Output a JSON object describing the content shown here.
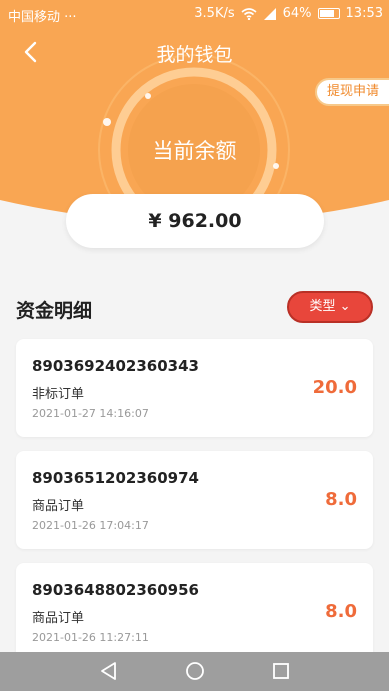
{
  "status_bar": {
    "carrier": "中国移动 ···",
    "network_speed": "3.5K/s",
    "battery": "64%",
    "time": "13:53"
  },
  "header": {
    "title": "我的钱包",
    "withdraw_label": "提现申请",
    "balance_label": "当前余额",
    "balance_value": "¥ 962.00"
  },
  "details": {
    "section_title": "资金明细",
    "filter_label": "类型 ⌄",
    "records": [
      {
        "order_no": "8903692402360343",
        "type": "非标订单",
        "time": "2021-01-27 14:16:07",
        "amount": "20.0"
      },
      {
        "order_no": "8903651202360974",
        "type": "商品订单",
        "time": "2021-01-26 17:04:17",
        "amount": "8.0"
      },
      {
        "order_no": "8903648802360956",
        "type": "商品订单",
        "time": "2021-01-26 11:27:11",
        "amount": "8.0"
      }
    ]
  },
  "colors": {
    "header_orange": "#f9a653",
    "accent_red": "#e8463b",
    "amount_orange": "#ef6b3a"
  },
  "icons": [
    "back-arrow-icon",
    "wifi-icon",
    "signal-icon",
    "battery-icon",
    "nav-back-icon",
    "nav-home-icon",
    "nav-recent-icon"
  ]
}
